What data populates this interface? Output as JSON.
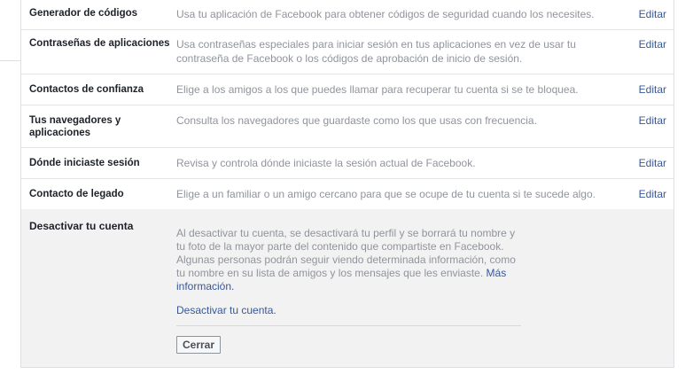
{
  "rows": [
    {
      "label": "Generador de códigos",
      "desc": "Usa tu aplicación de Facebook para obtener códigos de seguridad cuando los necesites.",
      "edit": "Editar"
    },
    {
      "label": "Contraseñas de aplicaciones",
      "desc": "Usa contraseñas especiales para iniciar sesión en tus aplicaciones en vez de usar tu contraseña de Facebook o los códigos de aprobación de inicio de sesión.",
      "edit": "Editar"
    },
    {
      "label": "Contactos de confianza",
      "desc": "Elige a los amigos a los que puedes llamar para recuperar tu cuenta si se te bloquea.",
      "edit": "Editar"
    },
    {
      "label": "Tus navegadores y aplicaciones",
      "desc": "Consulta los navegadores que guardaste como los que usas con frecuencia.",
      "edit": "Editar"
    },
    {
      "label": "Dónde iniciaste sesión",
      "desc": "Revisa y controla dónde iniciaste la sesión actual de Facebook.",
      "edit": "Editar"
    },
    {
      "label": "Contacto de legado",
      "desc": "Elige a un familiar o un amigo cercano para que se ocupe de tu cuenta si te sucede algo.",
      "edit": "Editar"
    }
  ],
  "deactivate": {
    "title": "Desactivar tu cuenta",
    "text": "Al desactivar tu cuenta, se desactivará tu perfil y se borrará tu nombre y tu foto de la mayor parte del contenido que compartiste en Facebook. Algunas personas podrán seguir viendo determinada información, como tu nombre en su lista de amigos y los mensajes que les enviaste.",
    "more_link": "Más información.",
    "deactivate_link": "Desactivar tu cuenta.",
    "close_button": "Cerrar"
  }
}
